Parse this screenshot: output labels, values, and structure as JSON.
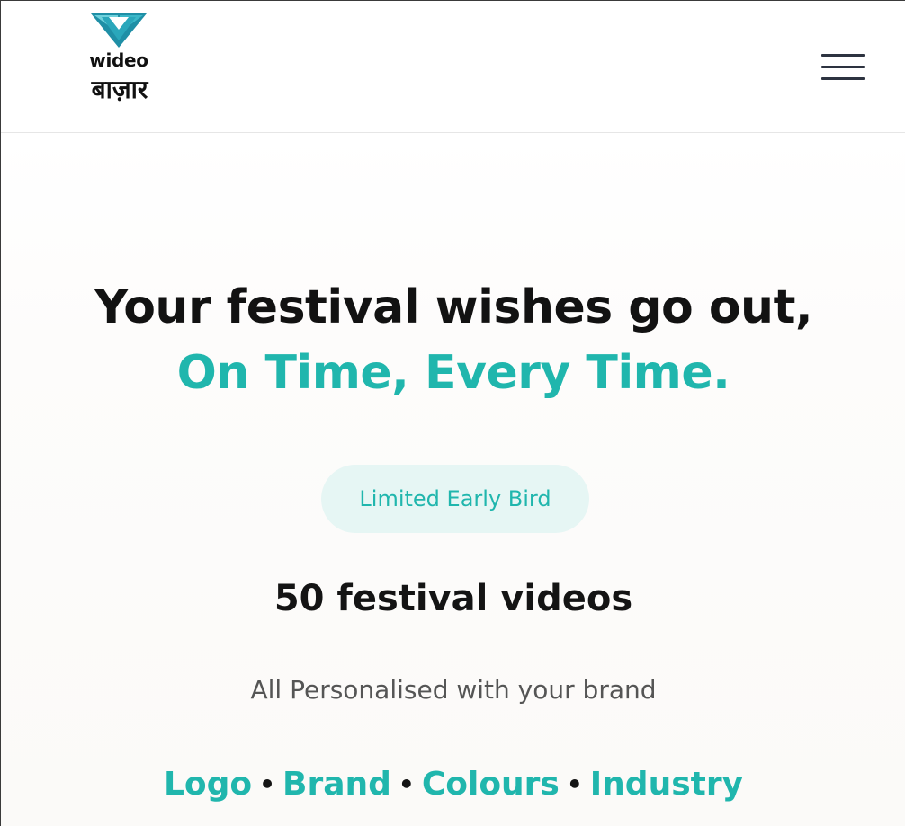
{
  "brand": {
    "name_latin": "wideo",
    "name_hindi": "बाज़ार",
    "accent_color": "#20b6ad",
    "logo_mark_color": "#3fb8c6"
  },
  "header": {
    "menu_icon": "hamburger-menu-icon"
  },
  "hero": {
    "headline_line1": "Your festival wishes go out,",
    "headline_line2": "On Time, Every Time.",
    "badge": "Limited Early Bird",
    "offer": "50 festival videos",
    "tagline": "All Personalised with your brand",
    "features": [
      "Logo",
      "Brand",
      "Colours",
      "Industry"
    ],
    "separator": "•"
  }
}
